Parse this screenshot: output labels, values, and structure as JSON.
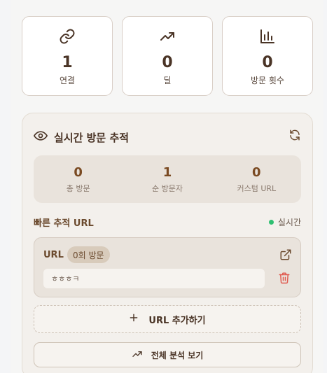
{
  "stats": [
    {
      "icon": "link-icon",
      "value": "1",
      "label": "연결"
    },
    {
      "icon": "trending-up-icon",
      "value": "0",
      "label": "딜"
    },
    {
      "icon": "bar-chart-icon",
      "value": "0",
      "label": "방문 횟수"
    }
  ],
  "tracking": {
    "title": "실시간 방문 추적",
    "summary": [
      {
        "value": "0",
        "label": "총 방문"
      },
      {
        "value": "1",
        "label": "순 방문자"
      },
      {
        "value": "0",
        "label": "커스텀 URL"
      }
    ],
    "quick_title": "빠른 추적 URL",
    "live_label": "실시간",
    "url_item": {
      "label": "URL",
      "badge": "0회 방문",
      "value": "ㅎㅎㅎㅋ"
    },
    "add_label": "URL 추가하기",
    "analyze_label": "전체 분석 보기"
  },
  "colors": {
    "accent_brown": "#4a3426",
    "live_green": "#2fbf71",
    "danger_red": "#e05a4f"
  }
}
